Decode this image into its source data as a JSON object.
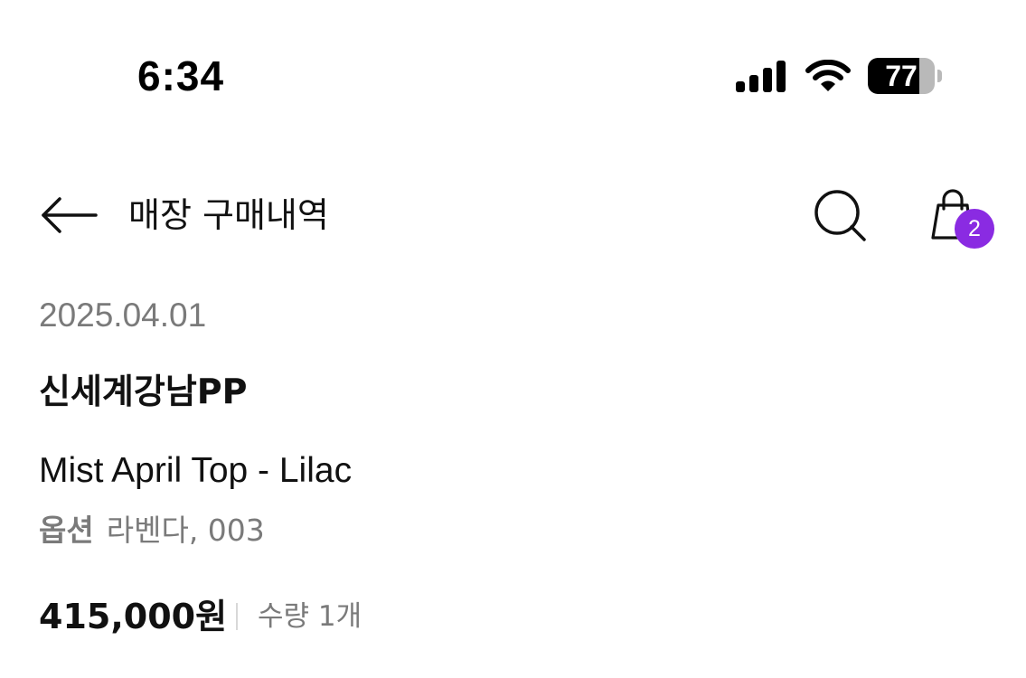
{
  "status_bar": {
    "time": "6:34",
    "battery_level": 77,
    "battery_text": "77",
    "icons": [
      "signal-icon",
      "wifi-icon",
      "battery-icon"
    ]
  },
  "header": {
    "title": "매장 구매내역",
    "cart_count": "2",
    "icons": [
      "arrow-left-icon",
      "search-icon",
      "shopping-bag-icon"
    ],
    "badge_color": "#8a2be2"
  },
  "purchase": {
    "date": "2025.04.01",
    "store": "신세계강남PP",
    "product_name": "Mist April Top - Lilac",
    "option_label": "옵션",
    "option_value": "라벤다, 003",
    "price": "415,000원",
    "quantity": "수량 1개"
  }
}
